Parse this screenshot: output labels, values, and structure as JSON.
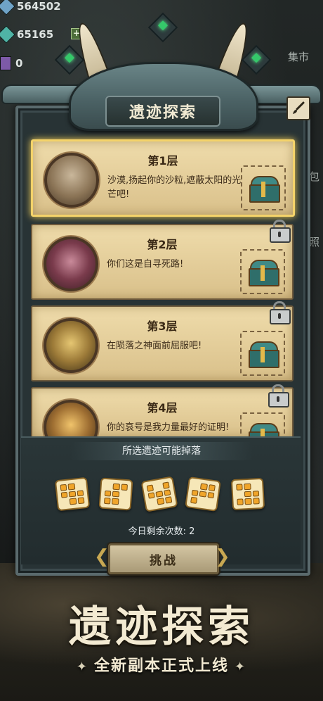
{
  "resources": [
    {
      "value": "564502",
      "icon": "gem-blue-icon",
      "color": "#6fa3c7"
    },
    {
      "value": "65165",
      "icon": "gem-teal-icon",
      "color": "#4fb3a5"
    },
    {
      "value": "0",
      "icon": "purple-card-icon",
      "color": "#7d5aa8"
    }
  ],
  "add_label": "+",
  "side_labels": {
    "market": "集市",
    "bag": "包",
    "photo": "照"
  },
  "panel": {
    "title": "遗迹探索"
  },
  "levels": [
    {
      "title": "第1层",
      "desc": "沙漠,扬起你的沙粒,遮蔽太阳的光芒吧!",
      "locked": false,
      "selected": true
    },
    {
      "title": "第2层",
      "desc": "你们这是自寻死路!",
      "locked": true,
      "selected": false
    },
    {
      "title": "第3层",
      "desc": "在陨落之神面前屈服吧!",
      "locked": true,
      "selected": false
    },
    {
      "title": "第4层",
      "desc": "你的哀号是我力量最好的证明!",
      "locked": true,
      "selected": false
    }
  ],
  "drops": {
    "title": "所选遗迹可能掉落",
    "count": 5
  },
  "remaining": "今日剩余次数: 2",
  "challenge_button": "挑战",
  "promo": {
    "title": "遗迹探索",
    "subtitle": "全新副本正式上线"
  }
}
